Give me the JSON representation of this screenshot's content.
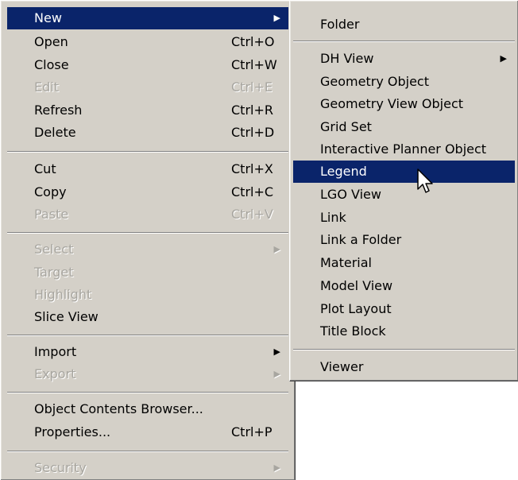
{
  "main_menu": {
    "items": [
      {
        "label": "New",
        "shortcut": "",
        "submenu": true,
        "disabled": false,
        "selected": true
      },
      {
        "label": "Open",
        "shortcut": "Ctrl+O",
        "disabled": false
      },
      {
        "label": "Close",
        "shortcut": "Ctrl+W",
        "disabled": false
      },
      {
        "label": "Edit",
        "shortcut": "Ctrl+E",
        "disabled": true
      },
      {
        "label": "Refresh",
        "shortcut": "Ctrl+R",
        "disabled": false
      },
      {
        "label": "Delete",
        "shortcut": "Ctrl+D",
        "disabled": false
      },
      {
        "label": "Cut",
        "shortcut": "Ctrl+X",
        "disabled": false
      },
      {
        "label": "Copy",
        "shortcut": "Ctrl+C",
        "disabled": false
      },
      {
        "label": "Paste",
        "shortcut": "Ctrl+V",
        "disabled": true
      },
      {
        "label": "Select",
        "shortcut": "",
        "submenu": true,
        "disabled": true
      },
      {
        "label": "Target",
        "shortcut": "",
        "disabled": true
      },
      {
        "label": "Highlight",
        "shortcut": "",
        "disabled": true
      },
      {
        "label": "Slice View",
        "shortcut": "",
        "disabled": false
      },
      {
        "label": "Import",
        "shortcut": "",
        "submenu": true,
        "disabled": false
      },
      {
        "label": "Export",
        "shortcut": "",
        "submenu": true,
        "disabled": true
      },
      {
        "label": "Object Contents Browser...",
        "shortcut": "",
        "disabled": false
      },
      {
        "label": "Properties...",
        "shortcut": "Ctrl+P",
        "disabled": false
      },
      {
        "label": "Security",
        "shortcut": "",
        "submenu": true,
        "disabled": true
      }
    ]
  },
  "new_submenu": {
    "items": [
      {
        "label": "Folder"
      },
      {
        "label": "DH View",
        "submenu": true
      },
      {
        "label": "Geometry Object"
      },
      {
        "label": "Geometry View Object"
      },
      {
        "label": "Grid Set"
      },
      {
        "label": "Interactive Planner Object"
      },
      {
        "label": "Legend",
        "selected": true
      },
      {
        "label": "LGO View"
      },
      {
        "label": "Link"
      },
      {
        "label": "Link a Folder"
      },
      {
        "label": "Material"
      },
      {
        "label": "Model View"
      },
      {
        "label": "Plot Layout"
      },
      {
        "label": "Title Block"
      },
      {
        "label": "Viewer"
      }
    ]
  },
  "icons": {
    "submenu_arrow": "triangle-right-icon",
    "cursor": "mouse-pointer-icon"
  },
  "colors": {
    "menu_bg": "#d4d0c8",
    "highlight_bg": "#0a246a",
    "highlight_fg": "#ffffff",
    "disabled_fg": "#a8a6a0"
  }
}
